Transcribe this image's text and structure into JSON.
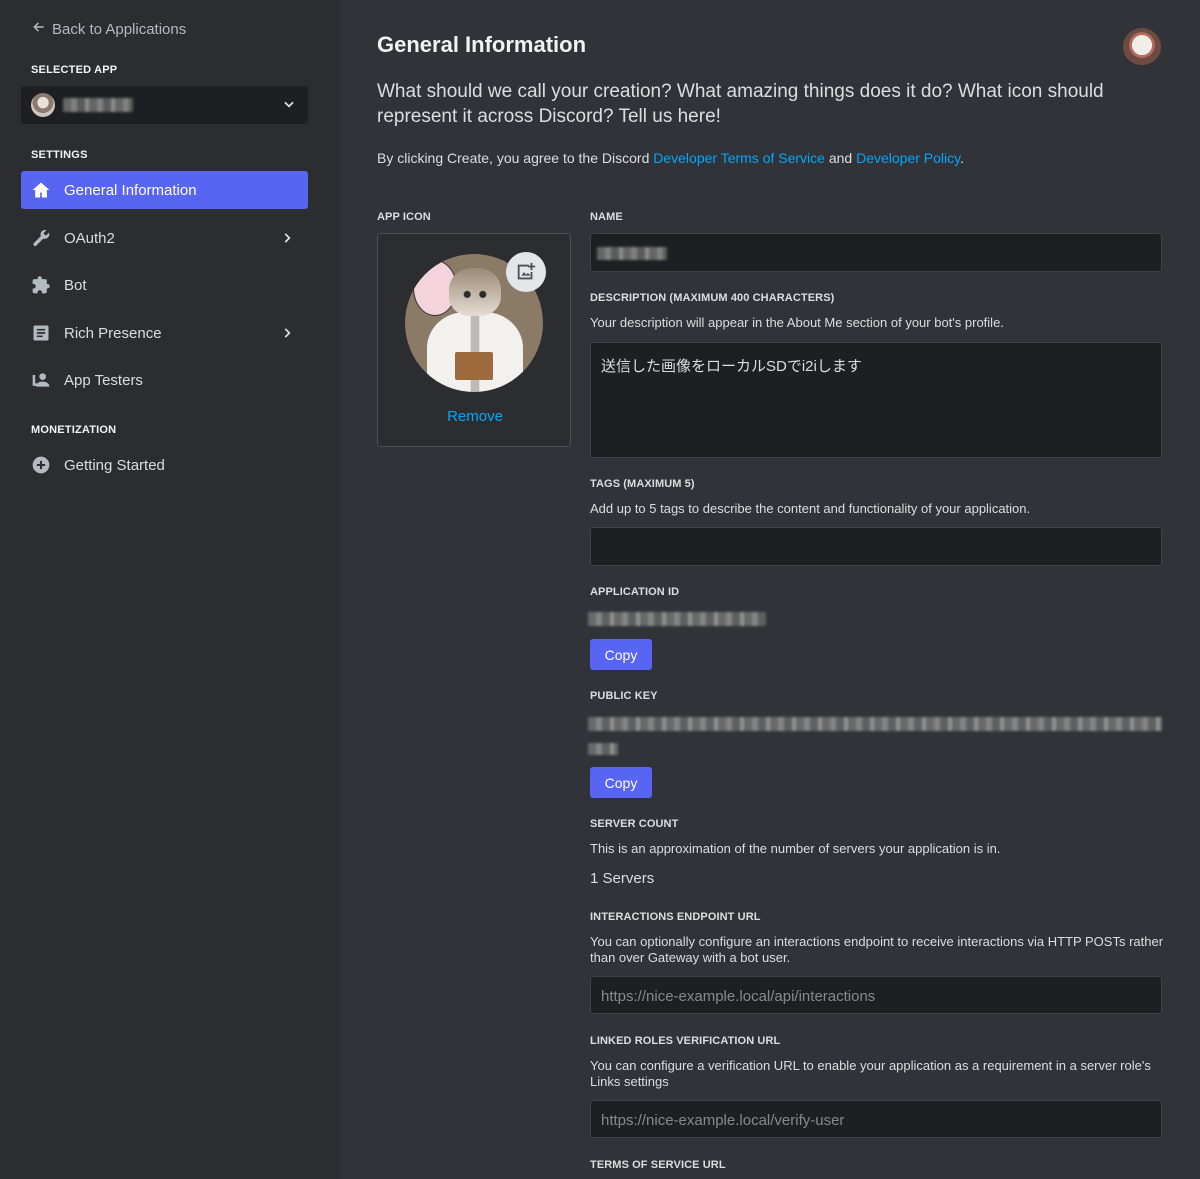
{
  "sidebar": {
    "back_label": "Back to Applications",
    "selected_app_heading": "SELECTED APP",
    "settings_heading": "SETTINGS",
    "monetization_heading": "MONETIZATION",
    "items": [
      {
        "label": "General Information",
        "icon": "home-icon",
        "active": true,
        "has_chevron": false
      },
      {
        "label": "OAuth2",
        "icon": "wrench-icon",
        "active": false,
        "has_chevron": true
      },
      {
        "label": "Bot",
        "icon": "puzzle-icon",
        "active": false,
        "has_chevron": false
      },
      {
        "label": "Rich Presence",
        "icon": "document-icon",
        "active": false,
        "has_chevron": true
      },
      {
        "label": "App Testers",
        "icon": "user-tester-icon",
        "active": false,
        "has_chevron": false
      }
    ],
    "monetization_items": [
      {
        "label": "Getting Started",
        "icon": "plus-circle-icon"
      }
    ]
  },
  "main": {
    "title": "General Information",
    "intro": "What should we call your creation? What amazing things does it do? What icon should represent it across Discord? Tell us here!",
    "agree_prefix": "By clicking Create, you agree to the Discord ",
    "agree_link1": "Developer Terms of Service",
    "agree_mid": " and ",
    "agree_link2": "Developer Policy",
    "agree_suffix": ".",
    "app_icon_label": "APP ICON",
    "remove_label": "Remove",
    "name_label": "NAME",
    "description_label": "DESCRIPTION (MAXIMUM 400 CHARACTERS)",
    "description_help": "Your description will appear in the About Me section of your bot's profile.",
    "description_value": "送信した画像をローカルSDでi2iします",
    "tags_label": "TAGS (MAXIMUM 5)",
    "tags_help": "Add up to 5 tags to describe the content and functionality of your application.",
    "application_id_label": "APPLICATION ID",
    "copy_label": "Copy",
    "public_key_label": "PUBLIC KEY",
    "server_count_label": "SERVER COUNT",
    "server_count_help": "This is an approximation of the number of servers your application is in.",
    "server_count_value": "1 Servers",
    "interactions_label": "INTERACTIONS ENDPOINT URL",
    "interactions_help": "You can optionally configure an interactions endpoint to receive interactions via HTTP POSTs rather than over Gateway with a bot user.",
    "interactions_placeholder": "https://nice-example.local/api/interactions",
    "linked_roles_label": "LINKED ROLES VERIFICATION URL",
    "linked_roles_help": "You can configure a verification URL to enable your application as a requirement in a server role's Links settings",
    "linked_roles_placeholder": "https://nice-example.local/verify-user",
    "tos_label": "TERMS OF SERVICE URL"
  },
  "colors": {
    "accent": "#5865f2",
    "link": "#00a8fc",
    "sidebar_bg": "#2b2d31",
    "main_bg": "#313338",
    "input_bg": "#1e1f22"
  }
}
